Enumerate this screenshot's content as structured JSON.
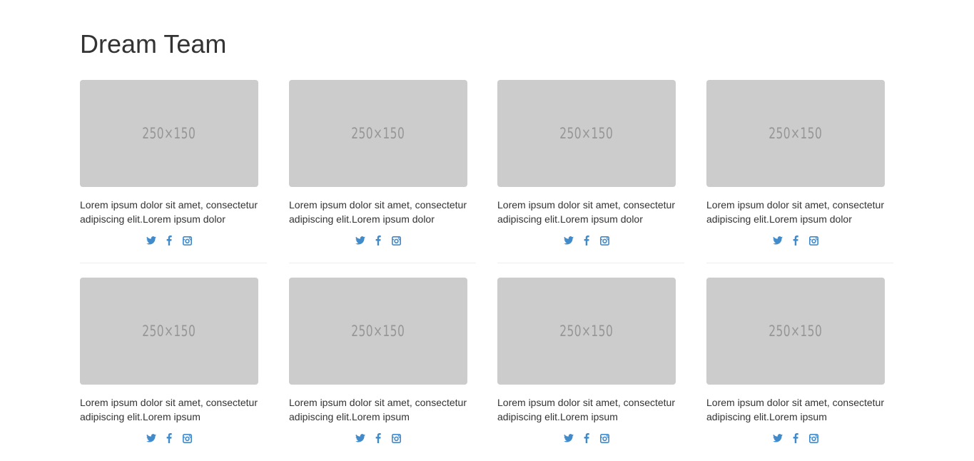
{
  "header": {
    "title": "Dream Team"
  },
  "colors": {
    "placeholder_bg": "#cccccc",
    "placeholder_text": "#969696",
    "social_icon": "#428bca",
    "divider": "#eeeeee"
  },
  "team": {
    "rows": [
      {
        "members": [
          {
            "image_label": "250×150",
            "description": "Lorem ipsum dolor sit amet, consectetur adipiscing elit.Lorem ipsum dolor",
            "social": [
              "twitter-icon",
              "facebook-icon",
              "instagram-icon"
            ]
          },
          {
            "image_label": "250×150",
            "description": "Lorem ipsum dolor sit amet, consectetur adipiscing elit.Lorem ipsum dolor",
            "social": [
              "twitter-icon",
              "facebook-icon",
              "instagram-icon"
            ]
          },
          {
            "image_label": "250×150",
            "description": "Lorem ipsum dolor sit amet, consectetur adipiscing elit.Lorem ipsum dolor",
            "social": [
              "twitter-icon",
              "facebook-icon",
              "instagram-icon"
            ]
          },
          {
            "image_label": "250×150",
            "description": "Lorem ipsum dolor sit amet, consectetur adipiscing elit.Lorem ipsum dolor",
            "social": [
              "twitter-icon",
              "facebook-icon",
              "instagram-icon"
            ]
          }
        ]
      },
      {
        "members": [
          {
            "image_label": "250×150",
            "description": "Lorem ipsum dolor sit amet, consectetur adipiscing elit.Lorem ipsum",
            "social": [
              "twitter-icon",
              "facebook-icon",
              "instagram-icon"
            ]
          },
          {
            "image_label": "250×150",
            "description": "Lorem ipsum dolor sit amet, consectetur adipiscing elit.Lorem ipsum",
            "social": [
              "twitter-icon",
              "facebook-icon",
              "instagram-icon"
            ]
          },
          {
            "image_label": "250×150",
            "description": "Lorem ipsum dolor sit amet, consectetur adipiscing elit.Lorem ipsum",
            "social": [
              "twitter-icon",
              "facebook-icon",
              "instagram-icon"
            ]
          },
          {
            "image_label": "250×150",
            "description": "Lorem ipsum dolor sit amet, consectetur adipiscing elit.Lorem ipsum",
            "social": [
              "twitter-icon",
              "facebook-icon",
              "instagram-icon"
            ]
          }
        ]
      }
    ]
  }
}
